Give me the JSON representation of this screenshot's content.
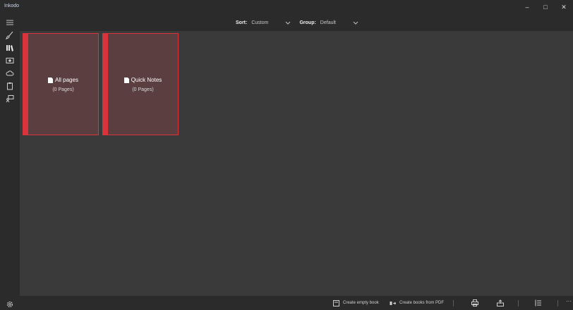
{
  "window": {
    "title": "Inkodo",
    "minimize": "–",
    "maximize": "□",
    "close": "✕"
  },
  "sidebar": {
    "items": [
      {
        "icon": "brush-icon"
      },
      {
        "icon": "books-icon"
      },
      {
        "icon": "picture-icon"
      },
      {
        "icon": "cloud-icon"
      },
      {
        "icon": "clipboard-icon"
      },
      {
        "icon": "presenter-icon"
      }
    ],
    "settings_icon": "gear-icon"
  },
  "toolbar": {
    "sort_label": "Sort:",
    "sort_value": "Custom",
    "group_label": "Group:",
    "group_value": "Default"
  },
  "books": [
    {
      "title": "All pages",
      "count": "(0 Pages)"
    },
    {
      "title": "Quick Notes",
      "count": "(0 Pages)"
    }
  ],
  "bottombar": {
    "create_empty": "Create empty book",
    "create_pdf": "Create books from PDF",
    "more": "···"
  },
  "colors": {
    "accent": "#d9333b",
    "book_fill": "#5b3f40",
    "chrome": "#2b2b2b",
    "canvas": "#3a3a3a"
  }
}
